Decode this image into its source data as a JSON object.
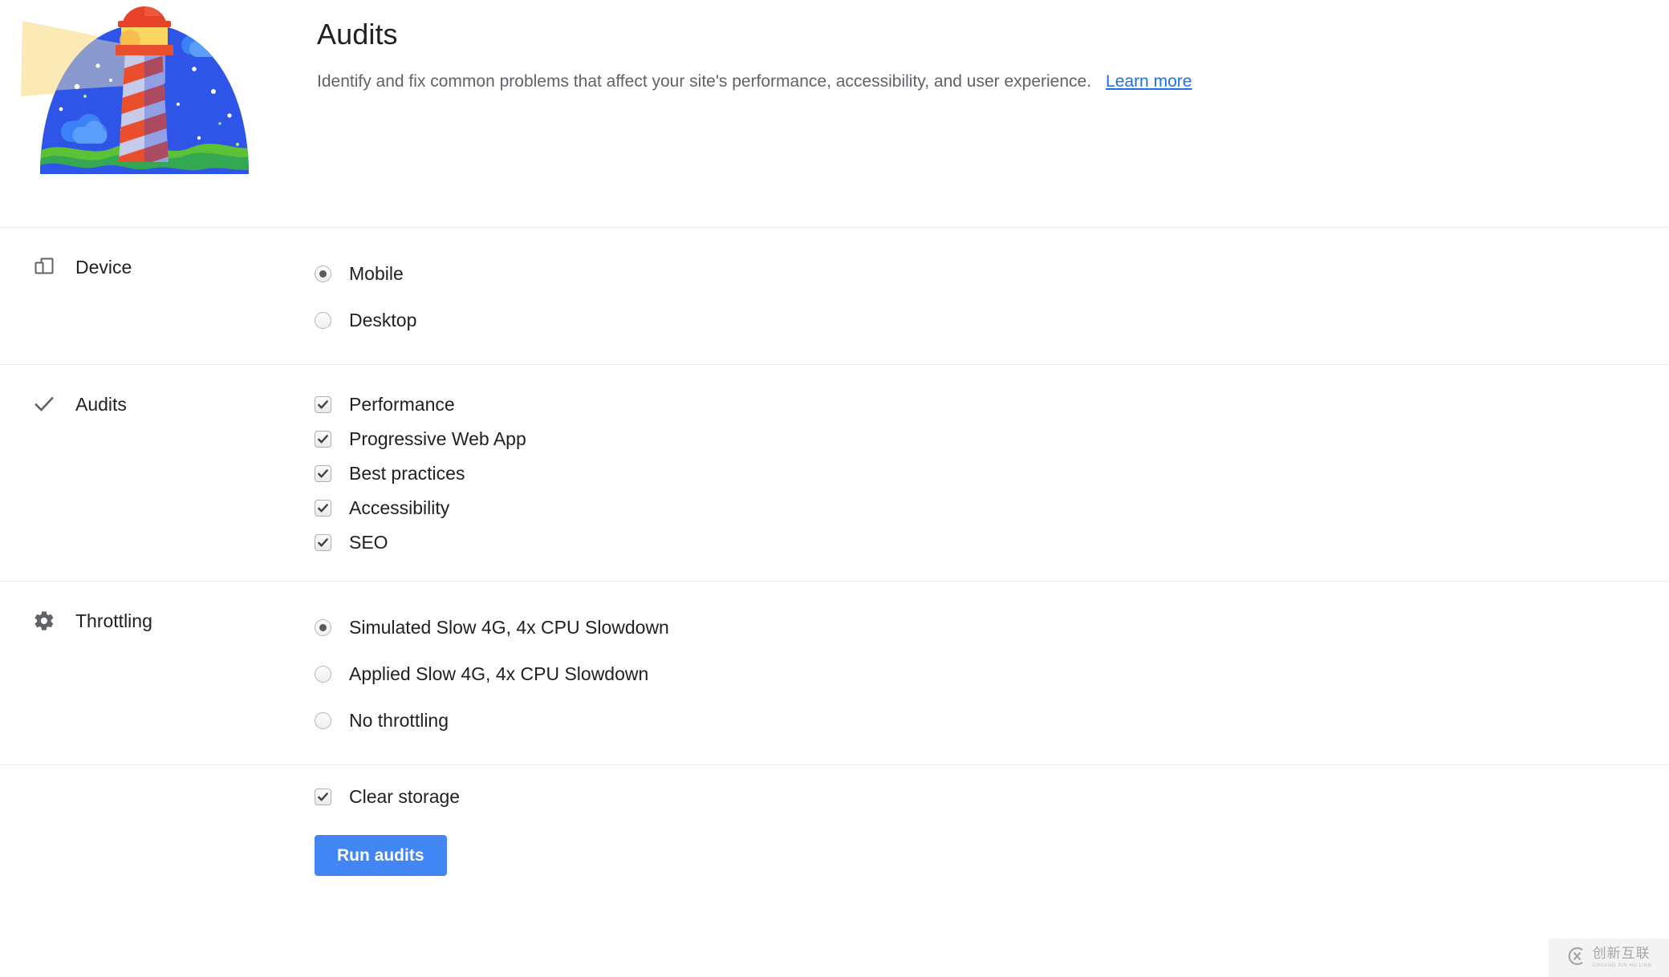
{
  "header": {
    "title": "Audits",
    "description": "Identify and fix common problems that affect your site's performance, accessibility, and user experience.",
    "learn_more_label": "Learn more",
    "illustration_name": "lighthouse-illustration"
  },
  "sections": [
    {
      "id": "device",
      "icon": "device-icon",
      "title": "Device",
      "control_type": "radio",
      "options": [
        {
          "label": "Mobile",
          "checked": true
        },
        {
          "label": "Desktop",
          "checked": false
        }
      ]
    },
    {
      "id": "audits",
      "icon": "check-icon",
      "title": "Audits",
      "control_type": "checkbox",
      "options": [
        {
          "label": "Performance",
          "checked": true
        },
        {
          "label": "Progressive Web App",
          "checked": true
        },
        {
          "label": "Best practices",
          "checked": true
        },
        {
          "label": "Accessibility",
          "checked": true
        },
        {
          "label": "SEO",
          "checked": true
        }
      ]
    },
    {
      "id": "throttling",
      "icon": "gear-icon",
      "title": "Throttling",
      "control_type": "radio",
      "options": [
        {
          "label": "Simulated Slow 4G, 4x CPU Slowdown",
          "checked": true
        },
        {
          "label": "Applied Slow 4G, 4x CPU Slowdown",
          "checked": false
        },
        {
          "label": "No throttling",
          "checked": false
        }
      ]
    }
  ],
  "footer": {
    "clear_storage": {
      "label": "Clear storage",
      "checked": true
    },
    "run_button_label": "Run audits"
  },
  "watermark": {
    "cn": "创新互联",
    "en": "CHUANG XIN HU LIAN"
  },
  "colors": {
    "accent_blue": "#4285f4",
    "link_blue": "#1a73e8",
    "text_primary": "#202124",
    "text_secondary": "#5f6368",
    "divider": "#ebebeb"
  }
}
